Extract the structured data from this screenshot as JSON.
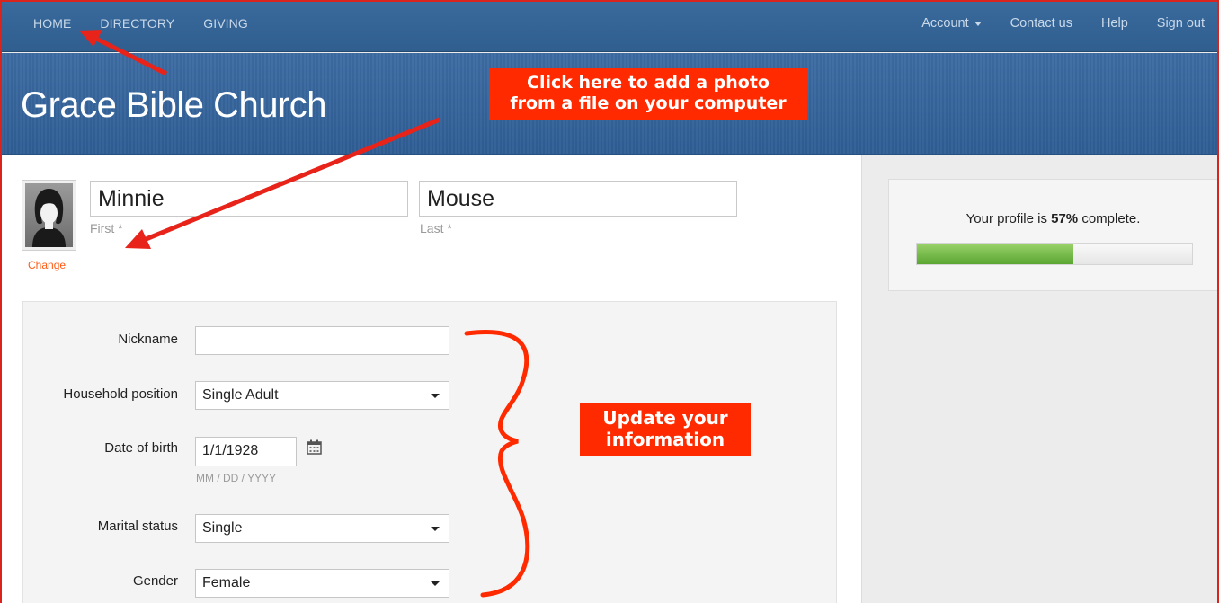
{
  "nav": {
    "left": [
      "HOME",
      "DIRECTORY",
      "GIVING"
    ],
    "account": "Account",
    "contact": "Contact us",
    "help": "Help",
    "signout": "Sign out"
  },
  "header": {
    "church_name": "Grace Bible Church"
  },
  "callouts": {
    "photo_line1": "Click here to add a photo",
    "photo_line2": "from a file on your computer",
    "update_line1": "Update your",
    "update_line2": "information"
  },
  "profile": {
    "change_link": "Change",
    "first_value": "Minnie",
    "first_hint": "First *",
    "last_value": "Mouse",
    "last_hint": "Last *"
  },
  "form": {
    "nickname_label": "Nickname",
    "nickname_value": "",
    "household_label": "Household position",
    "household_value": "Single Adult",
    "dob_label": "Date of birth",
    "dob_value": "1/1/1928",
    "dob_hint": "MM / DD / YYYY",
    "marital_label": "Marital status",
    "marital_value": "Single",
    "gender_label": "Gender",
    "gender_value": "Female"
  },
  "completeness": {
    "prefix": "Your profile is ",
    "percent": "57%",
    "suffix": " complete.",
    "fraction": 0.57
  },
  "colors": {
    "callout": "#ff2a00",
    "annotation": "#e8231a",
    "progress": "#6bb33d",
    "link": "#ff5a14"
  },
  "icons": [
    "calendar-icon",
    "dropdown-caret-icon",
    "avatar-silhouette-icon"
  ]
}
